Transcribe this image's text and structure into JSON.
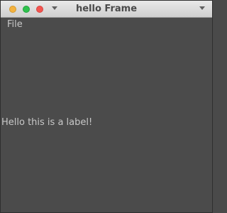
{
  "window": {
    "title": "hello Frame"
  },
  "menubar": {
    "items": [
      {
        "label": "File"
      }
    ]
  },
  "content": {
    "label_text": "Hello this is a label!"
  },
  "colors": {
    "background": "#4b4b4b",
    "text": "#c8c8c8",
    "titlebar": "#dcdcdc",
    "traffic_yellow": "#f4b23f",
    "traffic_green": "#2fc24e",
    "traffic_red": "#f2544f"
  }
}
